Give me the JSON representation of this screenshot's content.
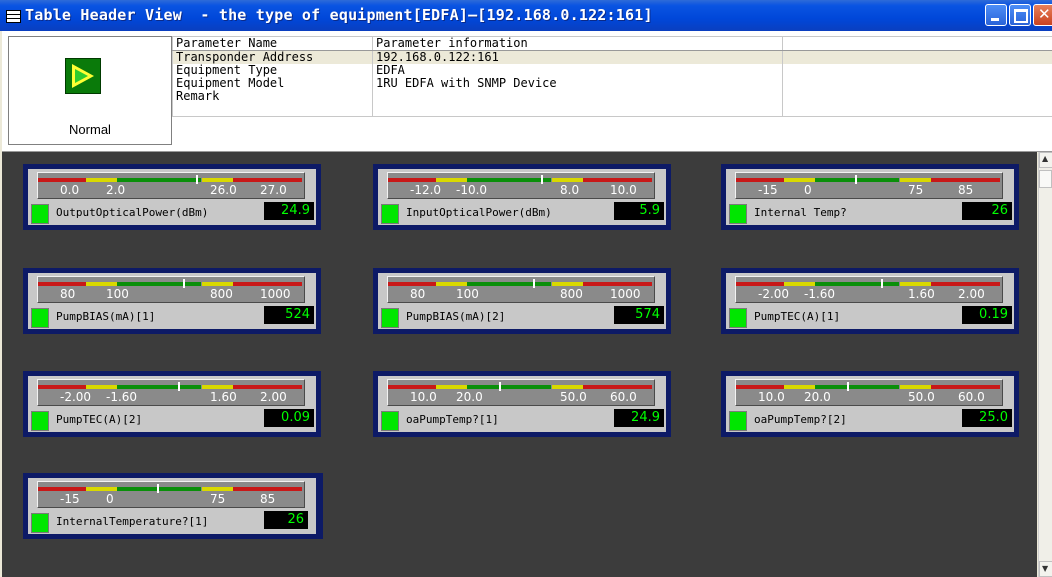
{
  "window": {
    "title": "Table Header View  - the type of equipment[EDFA]—[192.168.0.122:161]"
  },
  "status": {
    "label": "Normal",
    "icon": "status-normal-icon"
  },
  "params": {
    "col_name": "Parameter Name",
    "col_info": "Parameter information",
    "rows": [
      {
        "name": "Transponder Address",
        "info": "192.168.0.122:161"
      },
      {
        "name": "Equipment Type",
        "info": "EDFA"
      },
      {
        "name": "Equipment Model",
        "info": "1RU EDFA with SNMP Device"
      },
      {
        "name": "Remark",
        "info": ""
      }
    ]
  },
  "colors": {
    "alarm": "#c81818",
    "warn": "#d9d900",
    "ok": "#0a8f0a",
    "led": "#00e600",
    "value_text": "#00ff00"
  },
  "gauges": [
    {
      "label": "OutputOpticalPower(dBm)",
      "value": "24.9",
      "ticks": [
        "0.0",
        "2.0",
        "26.0",
        "27.0"
      ],
      "level": 0.6
    },
    {
      "label": "InputOpticalPower(dBm)",
      "value": "5.9",
      "ticks": [
        "-12.0",
        "-10.0",
        "8.0",
        "10.0"
      ],
      "level": 0.58
    },
    {
      "label": "Internal Temp?",
      "value": "26",
      "ticks": [
        "-15",
        "0",
        "75",
        "85"
      ],
      "level": 0.45
    },
    {
      "label": "PumpBIAS(mA)[1]",
      "value": "524",
      "ticks": [
        "80",
        "100",
        "800",
        "1000"
      ],
      "level": 0.55
    },
    {
      "label": "PumpBIAS(mA)[2]",
      "value": "574",
      "ticks": [
        "80",
        "100",
        "800",
        "1000"
      ],
      "level": 0.55
    },
    {
      "label": "PumpTEC(A)[1]",
      "value": "0.19",
      "ticks": [
        "-2.00",
        "-1.60",
        "1.60",
        "2.00"
      ],
      "level": 0.55
    },
    {
      "label": "PumpTEC(A)[2]",
      "value": "0.09",
      "ticks": [
        "-2.00",
        "-1.60",
        "1.60",
        "2.00"
      ],
      "level": 0.53
    },
    {
      "label": "oaPumpTemp?[1]",
      "value": "24.9",
      "ticks": [
        "10.0",
        "20.0",
        "50.0",
        "60.0"
      ],
      "level": 0.42
    },
    {
      "label": "oaPumpTemp?[2]",
      "value": "25.0",
      "ticks": [
        "10.0",
        "20.0",
        "50.0",
        "60.0"
      ],
      "level": 0.42
    },
    {
      "label": "InternalTemperature?[1]",
      "value": "26",
      "ticks": [
        "-15",
        "0",
        "75",
        "85"
      ],
      "level": 0.45
    }
  ]
}
